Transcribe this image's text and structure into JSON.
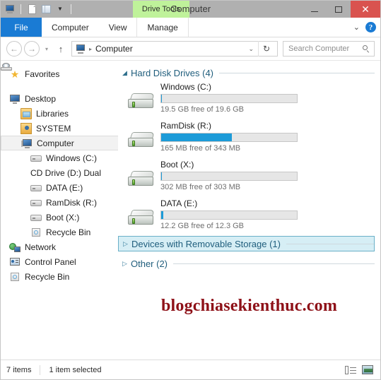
{
  "window": {
    "title": "Computer",
    "contextual_tab": "Drive Tools",
    "controls": {
      "minimize": "–",
      "maximize": "□",
      "close": "✕"
    }
  },
  "quick_access": {
    "items": [
      {
        "name": "computer-icon",
        "label": "Computer"
      },
      {
        "name": "properties-icon",
        "label": "Properties"
      },
      {
        "name": "new-folder-icon",
        "label": "New folder"
      }
    ],
    "caret": "▼"
  },
  "ribbon": {
    "file_tab": "File",
    "tabs": [
      "Computer",
      "View",
      "Manage"
    ],
    "expand_caret": "⌄",
    "help_label": "?"
  },
  "address_bar": {
    "back": "←",
    "forward": "→",
    "recent_caret": "▾",
    "up": "↑",
    "breadcrumb_sep": "▸",
    "breadcrumb": "Computer",
    "breadcrumb_caret": "⌄",
    "refresh": "↻",
    "search_placeholder": "Search Computer",
    "search_value": ""
  },
  "sidebar": {
    "items": [
      {
        "label": "Favorites",
        "icon": "star-icon",
        "indent": 0,
        "selected": false,
        "gap_after": true
      },
      {
        "label": "Desktop",
        "icon": "desktop-icon",
        "indent": 0,
        "selected": false
      },
      {
        "label": "Libraries",
        "icon": "libraries-icon",
        "indent": 1,
        "selected": false
      },
      {
        "label": "SYSTEM",
        "icon": "user-folder-icon",
        "indent": 1,
        "selected": false
      },
      {
        "label": "Computer",
        "icon": "computer-icon",
        "indent": 1,
        "selected": true
      },
      {
        "label": "Windows (C:)",
        "icon": "drive-icon",
        "indent": 2,
        "selected": false
      },
      {
        "label": "CD Drive (D:) Dual",
        "icon": "cd-drive-icon",
        "indent": 2,
        "selected": false
      },
      {
        "label": "DATA (E:)",
        "icon": "drive-icon",
        "indent": 2,
        "selected": false
      },
      {
        "label": "RamDisk (R:)",
        "icon": "drive-icon",
        "indent": 2,
        "selected": false
      },
      {
        "label": "Boot (X:)",
        "icon": "drive-icon",
        "indent": 2,
        "selected": false
      },
      {
        "label": "Recycle Bin",
        "icon": "recycle-bin-icon",
        "indent": 2,
        "selected": false
      },
      {
        "label": "Network",
        "icon": "network-icon",
        "indent": 0,
        "selected": false
      },
      {
        "label": "Control Panel",
        "icon": "control-panel-icon",
        "indent": 0,
        "selected": false
      },
      {
        "label": "Recycle Bin",
        "icon": "recycle-bin-icon",
        "indent": 0,
        "selected": false
      }
    ]
  },
  "content": {
    "groups": [
      {
        "title": "Hard Disk Drives (4)",
        "expanded": true,
        "selected": false,
        "triangle": "◢"
      },
      {
        "title": "Devices with Removable Storage (1)",
        "expanded": false,
        "selected": true,
        "triangle": "▷"
      },
      {
        "title": "Other (2)",
        "expanded": false,
        "selected": false,
        "triangle": "▷"
      }
    ],
    "drives": [
      {
        "name": "Windows (C:)",
        "free": "19.5 GB free of 19.6 GB",
        "used_percent": 0.5
      },
      {
        "name": "RamDisk (R:)",
        "free": "165 MB free of 343 MB",
        "used_percent": 52
      },
      {
        "name": "Boot (X:)",
        "free": "302 MB free of 303 MB",
        "used_percent": 0.3
      },
      {
        "name": "DATA (E:)",
        "free": "12.2 GB free of 12.3 GB",
        "used_percent": 1
      }
    ],
    "watermark": "blogchiasekienthuc.com"
  },
  "status_bar": {
    "item_count": "7 items",
    "selection": "1 item selected",
    "views": [
      {
        "name": "details-view-button"
      },
      {
        "name": "large-icons-view-button"
      }
    ]
  },
  "colors": {
    "accent_blue": "#1a7bd4",
    "bar_fill": "#1d9bd8",
    "close_red": "#d9534f",
    "contextual_green": "#bff29a",
    "group_selected_bg": "#d6eef5",
    "group_title": "#1f5d7c",
    "watermark_red": "#8e1118"
  }
}
